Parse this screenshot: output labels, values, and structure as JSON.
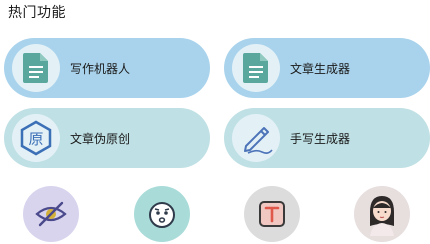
{
  "section": {
    "title": "热门功能"
  },
  "cards": [
    {
      "label": "写作机器人",
      "icon": "document-icon",
      "bg": "#a9d3ec"
    },
    {
      "label": "文章生成器",
      "icon": "document-icon",
      "bg": "#a9d3ec"
    },
    {
      "label": "文章伪原创",
      "icon": "original-seal-icon",
      "bg": "#bfe0e4"
    },
    {
      "label": "手写生成器",
      "icon": "pen-writing-icon",
      "bg": "#bfe0e4"
    }
  ],
  "bottom_icons": [
    {
      "icon": "eye-slash-icon",
      "bg": "#d9d4ee"
    },
    {
      "icon": "emoji-face-icon",
      "bg": "#a9dcd9"
    },
    {
      "icon": "text-t-icon",
      "bg": "#dcdcdc"
    },
    {
      "icon": "girl-avatar-icon",
      "bg": "#e7dede"
    }
  ]
}
